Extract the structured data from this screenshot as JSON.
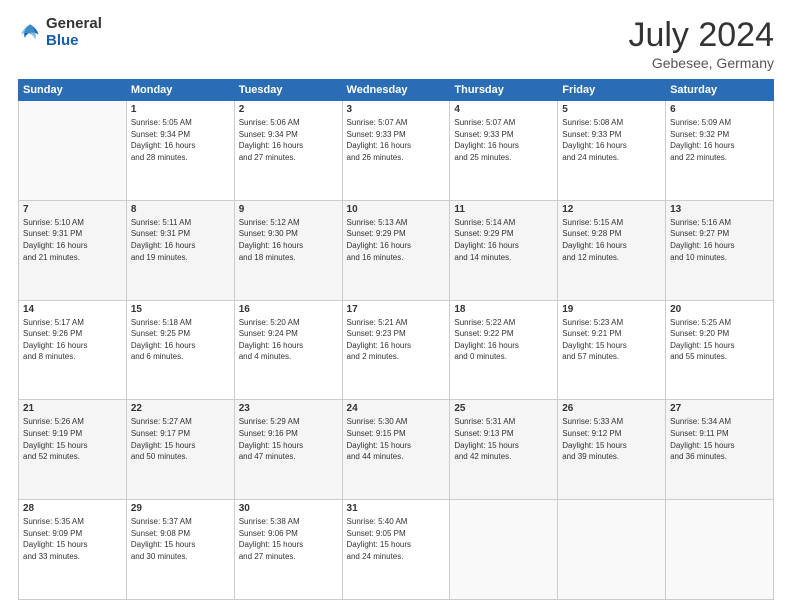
{
  "logo": {
    "line1": "General",
    "line2": "Blue"
  },
  "title": "July 2024",
  "location": "Gebesee, Germany",
  "days_of_week": [
    "Sunday",
    "Monday",
    "Tuesday",
    "Wednesday",
    "Thursday",
    "Friday",
    "Saturday"
  ],
  "weeks": [
    [
      {
        "day": "",
        "info": ""
      },
      {
        "day": "1",
        "info": "Sunrise: 5:05 AM\nSunset: 9:34 PM\nDaylight: 16 hours\nand 28 minutes."
      },
      {
        "day": "2",
        "info": "Sunrise: 5:06 AM\nSunset: 9:34 PM\nDaylight: 16 hours\nand 27 minutes."
      },
      {
        "day": "3",
        "info": "Sunrise: 5:07 AM\nSunset: 9:33 PM\nDaylight: 16 hours\nand 26 minutes."
      },
      {
        "day": "4",
        "info": "Sunrise: 5:07 AM\nSunset: 9:33 PM\nDaylight: 16 hours\nand 25 minutes."
      },
      {
        "day": "5",
        "info": "Sunrise: 5:08 AM\nSunset: 9:33 PM\nDaylight: 16 hours\nand 24 minutes."
      },
      {
        "day": "6",
        "info": "Sunrise: 5:09 AM\nSunset: 9:32 PM\nDaylight: 16 hours\nand 22 minutes."
      }
    ],
    [
      {
        "day": "7",
        "info": "Sunrise: 5:10 AM\nSunset: 9:31 PM\nDaylight: 16 hours\nand 21 minutes."
      },
      {
        "day": "8",
        "info": "Sunrise: 5:11 AM\nSunset: 9:31 PM\nDaylight: 16 hours\nand 19 minutes."
      },
      {
        "day": "9",
        "info": "Sunrise: 5:12 AM\nSunset: 9:30 PM\nDaylight: 16 hours\nand 18 minutes."
      },
      {
        "day": "10",
        "info": "Sunrise: 5:13 AM\nSunset: 9:29 PM\nDaylight: 16 hours\nand 16 minutes."
      },
      {
        "day": "11",
        "info": "Sunrise: 5:14 AM\nSunset: 9:29 PM\nDaylight: 16 hours\nand 14 minutes."
      },
      {
        "day": "12",
        "info": "Sunrise: 5:15 AM\nSunset: 9:28 PM\nDaylight: 16 hours\nand 12 minutes."
      },
      {
        "day": "13",
        "info": "Sunrise: 5:16 AM\nSunset: 9:27 PM\nDaylight: 16 hours\nand 10 minutes."
      }
    ],
    [
      {
        "day": "14",
        "info": "Sunrise: 5:17 AM\nSunset: 9:26 PM\nDaylight: 16 hours\nand 8 minutes."
      },
      {
        "day": "15",
        "info": "Sunrise: 5:18 AM\nSunset: 9:25 PM\nDaylight: 16 hours\nand 6 minutes."
      },
      {
        "day": "16",
        "info": "Sunrise: 5:20 AM\nSunset: 9:24 PM\nDaylight: 16 hours\nand 4 minutes."
      },
      {
        "day": "17",
        "info": "Sunrise: 5:21 AM\nSunset: 9:23 PM\nDaylight: 16 hours\nand 2 minutes."
      },
      {
        "day": "18",
        "info": "Sunrise: 5:22 AM\nSunset: 9:22 PM\nDaylight: 16 hours\nand 0 minutes."
      },
      {
        "day": "19",
        "info": "Sunrise: 5:23 AM\nSunset: 9:21 PM\nDaylight: 15 hours\nand 57 minutes."
      },
      {
        "day": "20",
        "info": "Sunrise: 5:25 AM\nSunset: 9:20 PM\nDaylight: 15 hours\nand 55 minutes."
      }
    ],
    [
      {
        "day": "21",
        "info": "Sunrise: 5:26 AM\nSunset: 9:19 PM\nDaylight: 15 hours\nand 52 minutes."
      },
      {
        "day": "22",
        "info": "Sunrise: 5:27 AM\nSunset: 9:17 PM\nDaylight: 15 hours\nand 50 minutes."
      },
      {
        "day": "23",
        "info": "Sunrise: 5:29 AM\nSunset: 9:16 PM\nDaylight: 15 hours\nand 47 minutes."
      },
      {
        "day": "24",
        "info": "Sunrise: 5:30 AM\nSunset: 9:15 PM\nDaylight: 15 hours\nand 44 minutes."
      },
      {
        "day": "25",
        "info": "Sunrise: 5:31 AM\nSunset: 9:13 PM\nDaylight: 15 hours\nand 42 minutes."
      },
      {
        "day": "26",
        "info": "Sunrise: 5:33 AM\nSunset: 9:12 PM\nDaylight: 15 hours\nand 39 minutes."
      },
      {
        "day": "27",
        "info": "Sunrise: 5:34 AM\nSunset: 9:11 PM\nDaylight: 15 hours\nand 36 minutes."
      }
    ],
    [
      {
        "day": "28",
        "info": "Sunrise: 5:35 AM\nSunset: 9:09 PM\nDaylight: 15 hours\nand 33 minutes."
      },
      {
        "day": "29",
        "info": "Sunrise: 5:37 AM\nSunset: 9:08 PM\nDaylight: 15 hours\nand 30 minutes."
      },
      {
        "day": "30",
        "info": "Sunrise: 5:38 AM\nSunset: 9:06 PM\nDaylight: 15 hours\nand 27 minutes."
      },
      {
        "day": "31",
        "info": "Sunrise: 5:40 AM\nSunset: 9:05 PM\nDaylight: 15 hours\nand 24 minutes."
      },
      {
        "day": "",
        "info": ""
      },
      {
        "day": "",
        "info": ""
      },
      {
        "day": "",
        "info": ""
      }
    ]
  ]
}
